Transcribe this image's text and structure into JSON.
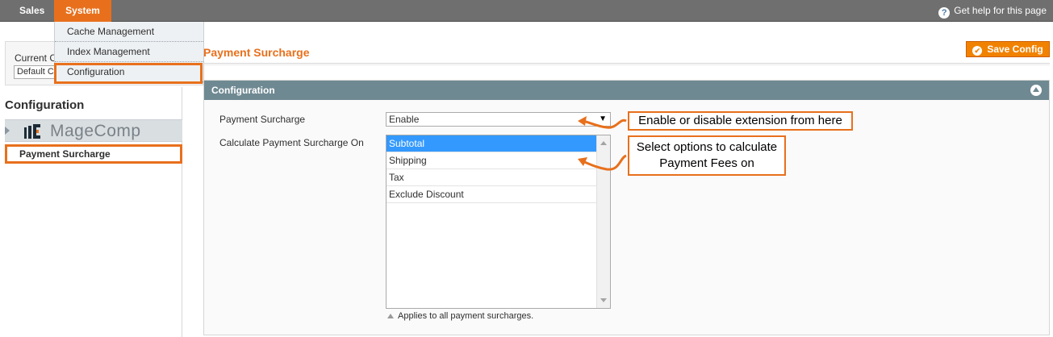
{
  "nav": {
    "items": [
      "Sales",
      "System"
    ],
    "help": "Get help for this page"
  },
  "dropdown": {
    "items": [
      "Cache Management",
      "Index Management",
      "Configuration"
    ]
  },
  "store": {
    "label": "Current C",
    "value": "Default C"
  },
  "left": {
    "title": "Configuration",
    "brand": "MageComp",
    "tab_item": "Payment Surcharge"
  },
  "main": {
    "page_title": "Payment Surcharge",
    "save_label": "Save Config",
    "section_title": "Configuration",
    "field1_label": "Payment Surcharge",
    "field1_value": "Enable",
    "field2_label": "Calculate Payment Surcharge On",
    "options": [
      "Subtotal",
      "Shipping",
      "Tax",
      "Exclude Discount"
    ],
    "note": "Applies to all payment surcharges."
  },
  "callouts": {
    "c1": "Enable or disable extension from here",
    "c2_line1": "Select options to calculate",
    "c2_line2": "Payment Fees on"
  },
  "colors": {
    "accent": "#e8701c",
    "nav_bg": "#6f6f6f",
    "section_head": "#6f8992",
    "selection": "#3399ff"
  },
  "icons": [
    "help-icon",
    "save-icon",
    "collapse-icon",
    "magecomp-logo-icon",
    "tab-arrow-icon",
    "dropdown-caret-icon"
  ]
}
